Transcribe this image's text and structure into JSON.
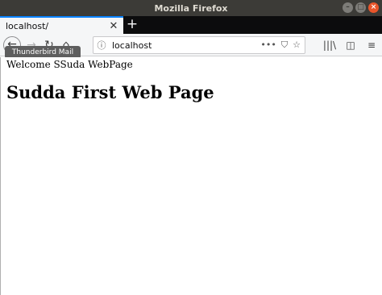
{
  "window": {
    "title": "Mozilla Firefox"
  },
  "tabs": [
    {
      "title": "localhost/"
    }
  ],
  "newtab_label": "+",
  "urlbar": {
    "url": "localhost"
  },
  "tooltip": "Thunderbird Mail",
  "page": {
    "welcome": "Welcome SSuda WebPage",
    "heading": "Sudda First Web Page"
  },
  "colors": {
    "tab_accent": "#0a84ff",
    "titlebar": "#3c3b37",
    "close_button": "#e9552a"
  },
  "icons": {
    "back": "back-arrow-icon",
    "forward": "forward-arrow-icon",
    "reload": "reload-icon",
    "home": "home-icon",
    "info": "info-icon",
    "page_actions": "more-icon",
    "pocket": "pocket-icon",
    "bookmark": "star-icon",
    "library": "library-icon",
    "sidebar": "sidebar-icon",
    "menu": "hamburger-menu-icon"
  }
}
